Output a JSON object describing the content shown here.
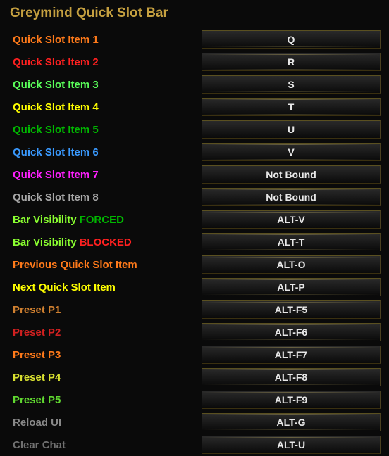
{
  "title": "Greymind Quick Slot Bar",
  "rows": [
    {
      "label": "Quick Slot Item 1",
      "labelClass": "c-orange",
      "binding": "Q"
    },
    {
      "label": "Quick Slot Item 2",
      "labelClass": "c-red",
      "binding": "R"
    },
    {
      "label": "Quick Slot Item 3",
      "labelClass": "c-lightgreen",
      "binding": "S"
    },
    {
      "label": "Quick Slot Item 4",
      "labelClass": "c-yellow",
      "binding": "T"
    },
    {
      "label": "Quick Slot Item 5",
      "labelClass": "c-green",
      "binding": "U"
    },
    {
      "label": "Quick Slot Item 6",
      "labelClass": "c-blue",
      "binding": "V"
    },
    {
      "label": "Quick Slot Item 7",
      "labelClass": "c-magenta",
      "binding": "Not Bound"
    },
    {
      "label": "Quick Slot Item 8",
      "labelClass": "c-gray",
      "binding": "Not Bound"
    },
    {
      "labelParts": [
        {
          "text": "Bar Visibility",
          "class": "c-lime"
        },
        {
          "text": "FORCED",
          "class": "c-green"
        }
      ],
      "binding": "ALT-V"
    },
    {
      "labelParts": [
        {
          "text": "Bar Visibility",
          "class": "c-lime"
        },
        {
          "text": "BLOCKED",
          "class": "c-red"
        }
      ],
      "binding": "ALT-T"
    },
    {
      "label": "Previous Quick Slot Item",
      "labelClass": "c-orange",
      "binding": "ALT-O"
    },
    {
      "label": "Next Quick Slot Item",
      "labelClass": "c-yellow",
      "binding": "ALT-P"
    },
    {
      "label": "Preset P1",
      "labelClass": "c-brown",
      "binding": "ALT-F5"
    },
    {
      "label": "Preset P2",
      "labelClass": "c-darkred",
      "binding": "ALT-F6"
    },
    {
      "label": "Preset P3",
      "labelClass": "c-orange",
      "binding": "ALT-F7"
    },
    {
      "label": "Preset P4",
      "labelClass": "c-olive",
      "binding": "ALT-F8"
    },
    {
      "label": "Preset P5",
      "labelClass": "c-lime2",
      "binding": "ALT-F9"
    },
    {
      "label": "Reload UI",
      "labelClass": "c-grayfade",
      "binding": "ALT-G"
    },
    {
      "label": "Clear Chat",
      "labelClass": "c-grayfade2",
      "binding": "ALT-U"
    }
  ]
}
